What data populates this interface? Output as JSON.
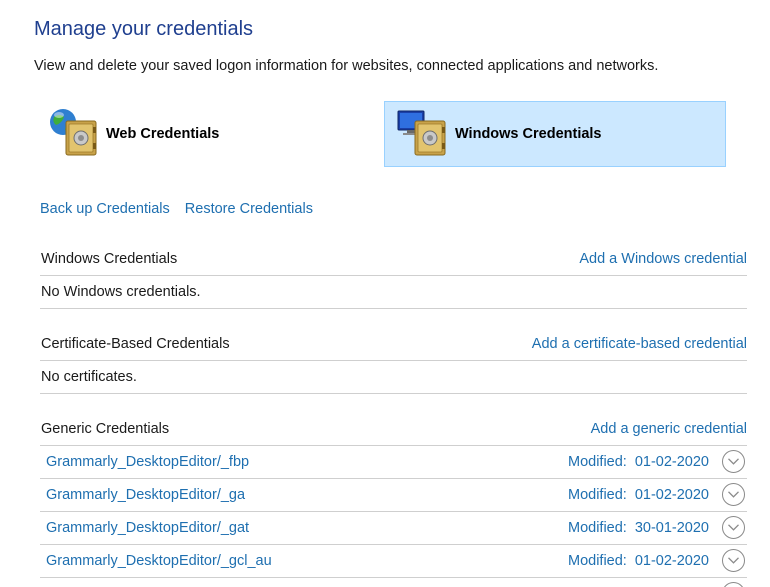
{
  "header": {
    "title": "Manage your credentials",
    "subtitle": "View and delete your saved logon information for websites, connected applications and networks."
  },
  "tabs": [
    {
      "label": "Web Credentials",
      "icon": "globe-safe-icon",
      "selected": false
    },
    {
      "label": "Windows Credentials",
      "icon": "computer-safe-icon",
      "selected": true
    }
  ],
  "actions": {
    "backup": "Back up Credentials",
    "restore": "Restore Credentials"
  },
  "sections": {
    "windows": {
      "title": "Windows Credentials",
      "action": "Add a Windows credential",
      "empty": "No Windows credentials."
    },
    "certificate": {
      "title": "Certificate-Based Credentials",
      "action": "Add a certificate-based credential",
      "empty": "No certificates."
    },
    "generic": {
      "title": "Generic Credentials",
      "action": "Add a generic credential",
      "items": [
        {
          "name": "Grammarly_DesktopEditor/_fbp",
          "modified_label": "Modified:",
          "date": "01-02-2020"
        },
        {
          "name": "Grammarly_DesktopEditor/_ga",
          "modified_label": "Modified:",
          "date": "01-02-2020"
        },
        {
          "name": "Grammarly_DesktopEditor/_gat",
          "modified_label": "Modified:",
          "date": "30-01-2020"
        },
        {
          "name": "Grammarly_DesktopEditor/_gcl_au",
          "modified_label": "Modified:",
          "date": "01-02-2020"
        }
      ]
    }
  },
  "colors": {
    "title": "#1f3f8f",
    "link": "#1e6fb0",
    "selected_tile_bg": "#cce8ff",
    "selected_tile_border": "#99d1ff",
    "divider": "#cfcfcf"
  }
}
